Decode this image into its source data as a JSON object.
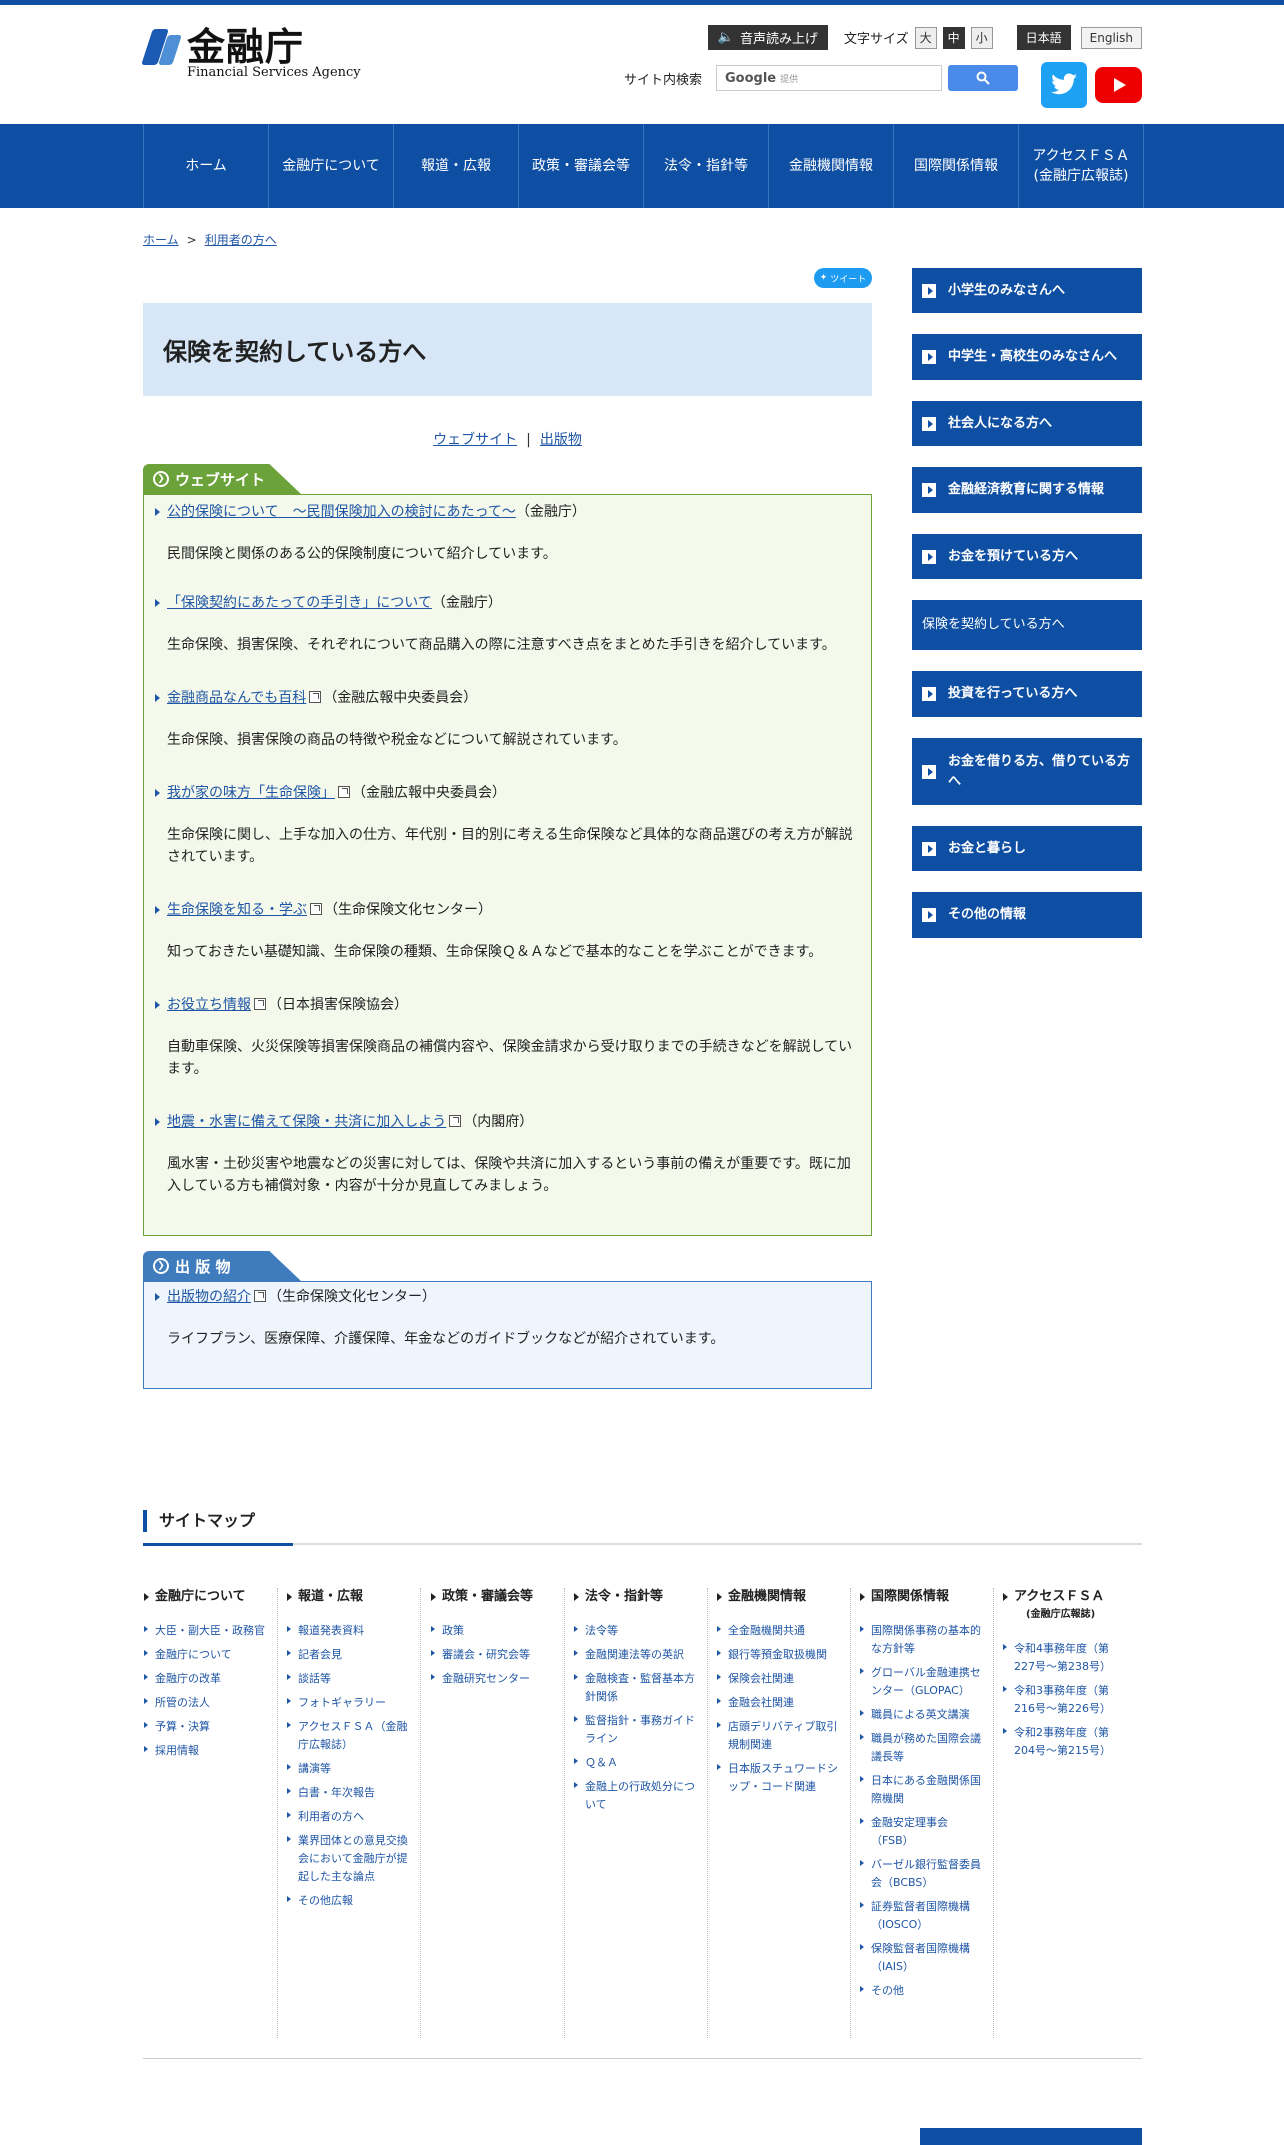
{
  "header": {
    "logo_jp": "金融庁",
    "logo_en": "Financial Services Agency",
    "voice_button": "音声読み上げ",
    "font_size_label": "文字サイズ",
    "font_sizes": [
      "大",
      "中",
      "小"
    ],
    "lang_ja": "日本語",
    "lang_en": "English",
    "search_label": "サイト内検索",
    "search_brand": "Google",
    "search_brand_sub": "提供"
  },
  "nav": [
    "ホーム",
    "金融庁について",
    "報道・広報",
    "政策・審議会等",
    "法令・指針等",
    "金融機関情報",
    "国際関係情報",
    "アクセスＦＳＡ\n(金融庁広報誌)"
  ],
  "breadcrumb": [
    "ホーム",
    "利用者の方へ"
  ],
  "main": {
    "tweet": "ツイート",
    "title": "保険を契約している方へ",
    "anchors": [
      "ウェブサイト",
      "出版物"
    ],
    "website_heading": "ウェブサイト",
    "publication_heading": "出 版 物",
    "websites": [
      {
        "link": "公的保険について　～民間保険加入の検討にあたって～",
        "org": "（金融庁）",
        "desc": "民間保険と関係のある公的保険制度について紹介しています。"
      },
      {
        "link": "「保険契約にあたっての手引き」について",
        "org": "（金融庁）",
        "desc": "生命保険、損害保険、それぞれについて商品購入の際に注意すべき点をまとめた手引きを紹介しています。"
      },
      {
        "link": "金融商品なんでも百科",
        "org": "（金融広報中央委員会）",
        "desc": "生命保険、損害保険の商品の特徴や税金などについて解説されています。"
      },
      {
        "link": "我が家の味方「生命保険」",
        "org": "（金融広報中央委員会）",
        "desc": "生命保険に関し、上手な加入の仕方、年代別・目的別に考える生命保険など具体的な商品選びの考え方が解説されています。"
      },
      {
        "link": "生命保険を知る・学ぶ",
        "org": "（生命保険文化センター）",
        "desc": "知っておきたい基礎知識、生命保険の種類、生命保険Ｑ＆Ａなどで基本的なことを学ぶことができます。"
      },
      {
        "link": "お役立ち情報",
        "org": "（日本損害保険協会）",
        "desc": "自動車保険、火災保険等損害保険商品の補償内容や、保険金請求から受け取りまでの手続きなどを解説しています。"
      },
      {
        "link": "地震・水害に備えて保険・共済に加入しよう",
        "org": "（内閣府）",
        "desc": "風水害・土砂災害や地震などの災害に対しては、保険や共済に加入するという事前の備えが重要です。既に加入している方も補償対象・内容が十分か見直してみましょう。"
      }
    ],
    "publications": [
      {
        "link": "出版物の紹介",
        "org": "（生命保険文化センター）",
        "desc": "ライフプラン、医療保障、介護保障、年金などのガイドブックなどが紹介されています。"
      }
    ]
  },
  "sidebar": [
    "小学生のみなさんへ",
    "中学生・高校生のみなさんへ",
    "社会人になる方へ",
    "金融経済教育に関する情報",
    "お金を預けている方へ",
    "保険を契約している方へ",
    "投資を行っている方へ",
    "お金を借りる方、借りている方へ",
    "お金と暮らし",
    "その他の情報"
  ],
  "sitemap": {
    "title": "サイトマップ",
    "columns": [
      {
        "heading": "金融庁について",
        "sub": "",
        "items": [
          "大臣・副大臣・政務官",
          "金融庁について",
          "金融庁の改革",
          "所管の法人",
          "予算・決算",
          "採用情報"
        ]
      },
      {
        "heading": "報道・広報",
        "sub": "",
        "items": [
          "報道発表資料",
          "記者会見",
          "談話等",
          "フォトギャラリー",
          "アクセスＦＳＡ（金融庁広報誌）",
          "講演等",
          "白書・年次報告",
          "利用者の方へ",
          "業界団体との意見交換会において金融庁が提起した主な論点",
          "その他広報"
        ]
      },
      {
        "heading": "政策・審議会等",
        "sub": "",
        "items": [
          "政策",
          "審議会・研究会等",
          "金融研究センター"
        ]
      },
      {
        "heading": "法令・指針等",
        "sub": "",
        "items": [
          "法令等",
          "金融関連法等の英訳",
          "金融検査・監督基本方針関係",
          "監督指針・事務ガイドライン",
          "Ｑ＆Ａ",
          "金融上の行政処分について"
        ]
      },
      {
        "heading": "金融機関情報",
        "sub": "",
        "items": [
          "全金融機関共通",
          "銀行等預金取扱機関",
          "保険会社関連",
          "金融会社関連",
          "店頭デリバティブ取引規制関連",
          "日本版スチュワードシップ・コード関連"
        ]
      },
      {
        "heading": "国際関係情報",
        "sub": "",
        "items": [
          "国際関係事務の基本的な方針等",
          "グローバル金融連携センター（GLOPAC）",
          "職員による英文講演",
          "職員が務めた国際会議議長等",
          "日本にある金融関係国際機関",
          "金融安定理事会（FSB）",
          "バーゼル銀行監督委員会（BCBS）",
          "証券監督者国際機構（IOSCO）",
          "保険監督者国際機構（IAIS）",
          "その他"
        ]
      },
      {
        "heading": "アクセスＦＳＡ",
        "sub": "(金融庁広報誌)",
        "items": [
          "令和4事務年度（第227号～第238号）",
          "令和3事務年度（第216号～第226号）",
          "令和2事務年度（第204号～第215号）"
        ]
      }
    ]
  }
}
